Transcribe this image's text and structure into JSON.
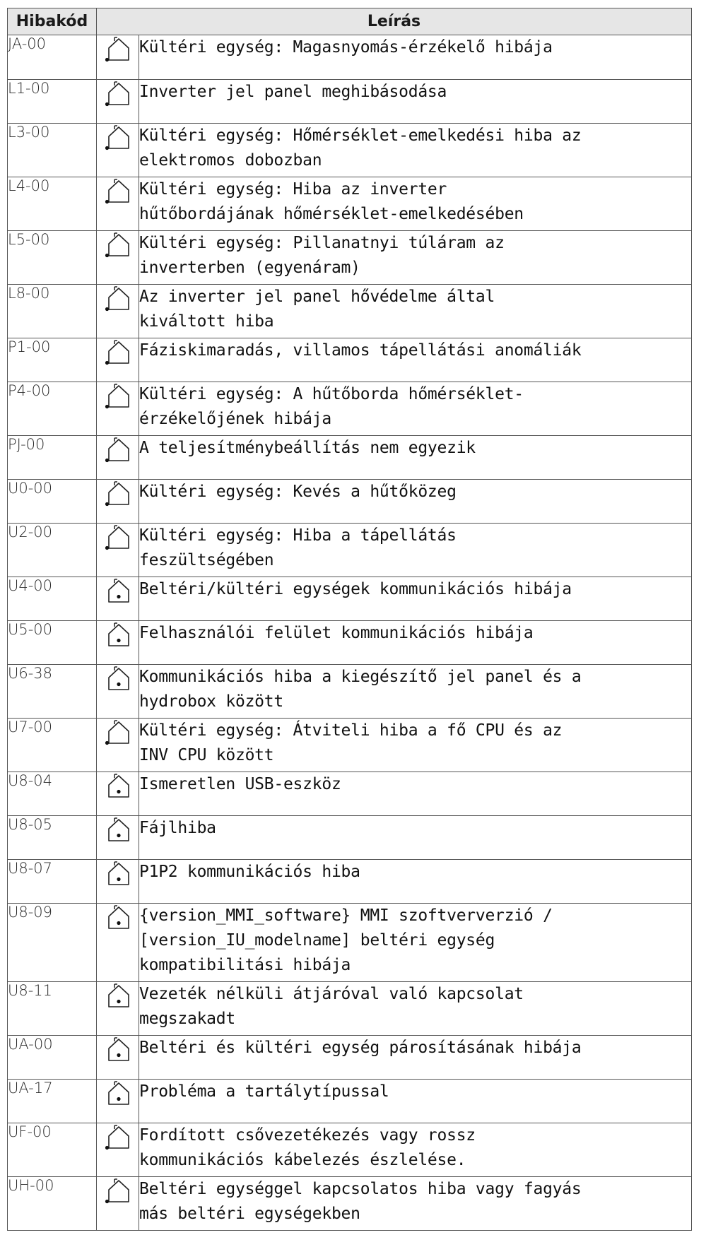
{
  "table": {
    "headers": {
      "code": "Hibakód",
      "desc": "Leírás"
    },
    "rows": [
      {
        "code": "JA-00",
        "icon": "outdoor-unit-icon",
        "desc": "Kültéri egység: Magasnyomás-érzékelő hibája"
      },
      {
        "code": "L1-00",
        "icon": "outdoor-unit-icon",
        "desc": "Inverter jel panel meghibásodása"
      },
      {
        "code": "L3-00",
        "icon": "outdoor-unit-icon",
        "desc": "Kültéri egység: Hőmérséklet-emelkedési hiba az\nelektromos dobozban"
      },
      {
        "code": "L4-00",
        "icon": "outdoor-unit-icon",
        "desc": "Kültéri egység: Hiba az inverter\nhűtőbordájának hőmérséklet-emelkedésében"
      },
      {
        "code": "L5-00",
        "icon": "outdoor-unit-icon",
        "desc": "Kültéri egység: Pillanatnyi túláram az\ninverterben (egyenáram)"
      },
      {
        "code": "L8-00",
        "icon": "outdoor-unit-icon",
        "desc": "Az inverter jel panel hővédelme által\nkiváltott hiba"
      },
      {
        "code": "P1-00",
        "icon": "outdoor-unit-icon",
        "desc": "Fáziskimaradás, villamos tápellátási anomáliák"
      },
      {
        "code": "P4-00",
        "icon": "outdoor-unit-icon",
        "desc": "Kültéri egység: A hűtőborda hőmérséklet-\nérzékelőjének hibája"
      },
      {
        "code": "PJ-00",
        "icon": "outdoor-unit-icon",
        "desc": "A teljesítménybeállítás nem egyezik"
      },
      {
        "code": "U0-00",
        "icon": "outdoor-unit-icon",
        "desc": "Kültéri egység: Kevés a hűtőközeg"
      },
      {
        "code": "U2-00",
        "icon": "outdoor-unit-icon",
        "desc": "Kültéri egység: Hiba a tápellátás\nfeszültségében"
      },
      {
        "code": "U4-00",
        "icon": "indoor-unit-icon",
        "desc": "Beltéri/kültéri egységek kommunikációs hibája"
      },
      {
        "code": "U5-00",
        "icon": "indoor-unit-icon",
        "desc": "Felhasználói felület kommunikációs hibája"
      },
      {
        "code": "U6-38",
        "icon": "indoor-unit-icon",
        "desc": "Kommunikációs hiba a kiegészítő jel panel és a\nhydrobox között"
      },
      {
        "code": "U7-00",
        "icon": "outdoor-unit-icon",
        "desc": "Kültéri egység: Átviteli hiba a fő CPU és az\nINV CPU között"
      },
      {
        "code": "U8-04",
        "icon": "indoor-unit-icon",
        "desc": "Ismeretlen USB-eszköz"
      },
      {
        "code": "U8-05",
        "icon": "indoor-unit-icon",
        "desc": "Fájlhiba"
      },
      {
        "code": "U8-07",
        "icon": "indoor-unit-icon",
        "desc": "P1P2 kommunikációs hiba"
      },
      {
        "code": "U8-09",
        "icon": "indoor-unit-icon",
        "desc": "{version_MMI_software} MMI szoftververzió /\n[version_IU_modelname] beltéri egység\nkompatibilitási hibája"
      },
      {
        "code": "U8-11",
        "icon": "indoor-unit-icon",
        "desc": "Vezeték nélküli átjáróval való kapcsolat\nmegszakadt"
      },
      {
        "code": "UA-00",
        "icon": "indoor-unit-icon",
        "desc": "Beltéri és kültéri egység párosításának hibája"
      },
      {
        "code": "UA-17",
        "icon": "indoor-unit-icon",
        "desc": "Probléma a tartálytípussal"
      },
      {
        "code": "UF-00",
        "icon": "outdoor-unit-icon",
        "desc": "Fordított csővezetékezés vagy rossz\nkommunikációs kábelezés észlelése."
      },
      {
        "code": "UH-00",
        "icon": "outdoor-unit-icon",
        "desc": "Beltéri egységgel kapcsolatos hiba vagy fagyás\nmás beltéri egységekben"
      }
    ]
  }
}
